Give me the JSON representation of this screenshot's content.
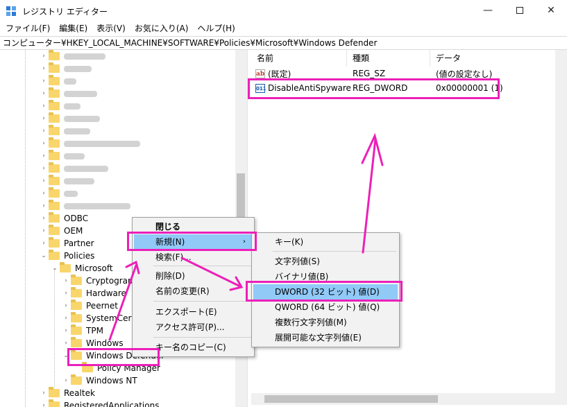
{
  "window": {
    "title": "レジストリ エディター",
    "minimize": "—",
    "close": "✕"
  },
  "menu": [
    "ファイル(F)",
    "編集(E)",
    "表示(V)",
    "お気に入り(A)",
    "ヘルプ(H)"
  ],
  "address": "コンピューター¥HKEY_LOCAL_MACHINE¥SOFTWARE¥Policies¥Microsoft¥Windows Defender",
  "tree": {
    "items": [
      {
        "label": "ODBC"
      },
      {
        "label": "OEM"
      },
      {
        "label": "Partner"
      },
      {
        "label": "Policies"
      },
      {
        "label": "Microsoft"
      },
      {
        "label": "Cryptography"
      },
      {
        "label": "Hardware"
      },
      {
        "label": "Peernet"
      },
      {
        "label": "SystemCertificates"
      },
      {
        "label": "TPM"
      },
      {
        "label": "Windows"
      },
      {
        "label": "Windows Defender"
      },
      {
        "label": "Policy Manager"
      },
      {
        "label": "Windows NT"
      },
      {
        "label": "Realtek"
      },
      {
        "label": "RegisteredApplications"
      }
    ]
  },
  "list": {
    "headers": [
      "名前",
      "種類",
      "データ"
    ],
    "rows": [
      {
        "name": "(既定)",
        "type": "REG_SZ",
        "data": "(値の設定なし)",
        "icon": "string-value-icon"
      },
      {
        "name": "DisableAntiSpyware",
        "type": "REG_DWORD",
        "data": "0x00000001 (1)",
        "icon": "binary-value-icon"
      }
    ]
  },
  "context_menu": {
    "items": [
      "閉じる",
      "新規(N)",
      "検索(F)...",
      "削除(D)",
      "名前の変更(R)",
      "エクスポート(E)",
      "アクセス許可(P)...",
      "キー名のコピー(C)"
    ]
  },
  "submenu": {
    "items": [
      "キー(K)",
      "文字列値(S)",
      "バイナリ値(B)",
      "DWORD (32 ビット) 値(D)",
      "QWORD (64 ビット) 値(Q)",
      "複数行文字列値(M)",
      "展開可能な文字列値(E)"
    ]
  },
  "colors": {
    "highlight": "#ec1fb9",
    "selection": "#91c9f7",
    "folder": "#f9d66b"
  }
}
